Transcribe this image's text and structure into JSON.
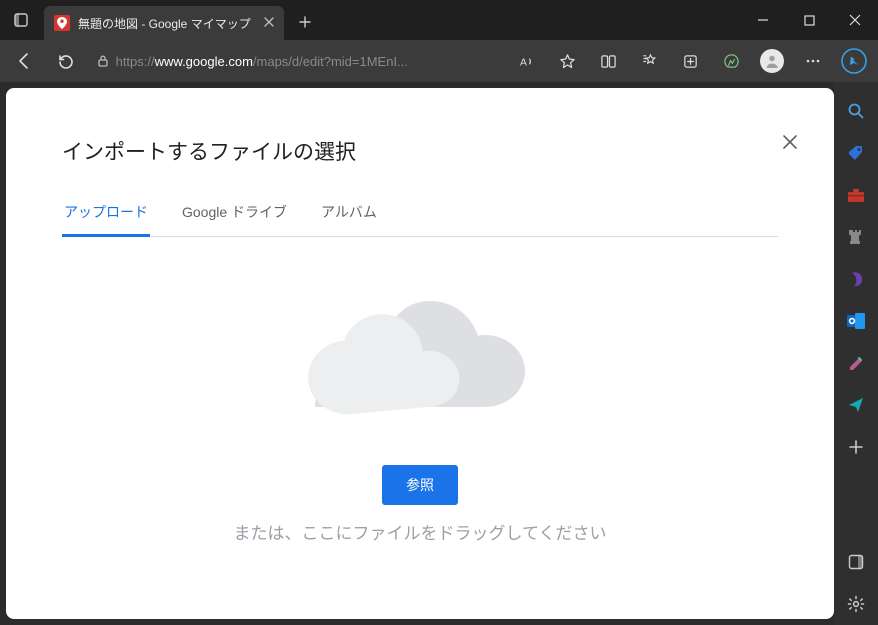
{
  "browser": {
    "tab_title": "無題の地図 - Google マイマップ",
    "url_prefix": "https://",
    "url_host": "www.google.com",
    "url_path": "/maps/d/edit?mid=1MEnI..."
  },
  "modal": {
    "title": "インポートするファイルの選択",
    "tabs": {
      "upload": "アップロード",
      "drive": "Google ドライブ",
      "album": "アルバム"
    },
    "browse_label": "参照",
    "drag_hint": "または、ここにファイルをドラッグしてください"
  }
}
